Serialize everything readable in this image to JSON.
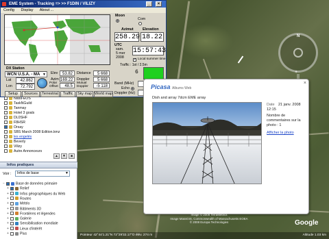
{
  "eme_window": {
    "title": "EME System - Tracking => >> F1DIN / VILIZY",
    "menu": [
      "Config",
      "Display",
      "About ..."
    ],
    "moon_label": "Moon",
    "com_label": "Com",
    "azimut_label": "Azimut",
    "elevation_label": "Elevation",
    "azimut_value": "258.29",
    "elevation_value": "18.22",
    "utc_label": "UTC",
    "date_line1": "sam.",
    "date_line2": "5 mer",
    "date_line3": "2008",
    "utc_time": "15:57:43",
    "local_summer_time_label": "Local summer time",
    "traffic_label": "Traffic : 1st / 2.5m",
    "dx_station_label": "DX Station",
    "dx_station_value": "WCN U.S.A. - MA",
    "lat_label": "Lat",
    "lat_value": "42.862",
    "lon_label": "Lon",
    "lon_value": "72.792",
    "elev_label": "Elev",
    "elev_value": "53.82",
    "distance_label": "Distance",
    "distance_value": "5 668",
    "azim_label": "Azim",
    "azim_value": "169.22",
    "doppler_label": "Doppler",
    "doppler_value": "5 668",
    "polar_offset_label": "Polar Offset",
    "polar_offset_value": "48.5",
    "mutual_doppler_label": "Mutual Doppler",
    "mutual_doppler_value": "-5 118",
    "band_label": "Band (MHz)",
    "band_value": "10 368",
    "echo_label": "Echo",
    "doppler_hz_label": "Doppler (Hz)",
    "doppler_hz_value": "-15 861",
    "indicator_value": "6",
    "buttons": [
      "Setup",
      "Sources",
      "Terrestrial",
      "Traffic",
      "Sky map",
      "World map"
    ]
  },
  "sidebar": {
    "tree_items": [
      {
        "label": "Nasa-EOS",
        "checked": false
      },
      {
        "label": "TaskNGuild",
        "checked": false
      },
      {
        "label": "Tanmay",
        "checked": false
      },
      {
        "label": "Hotel 3 goals",
        "checked": false
      },
      {
        "label": "DL0SHF",
        "checked": false
      },
      {
        "label": "F8HSR",
        "checked": false
      },
      {
        "label": "Orsay",
        "checked": true
      },
      {
        "label": "SBS March 2008 Edition.kmz",
        "checked": false
      },
      {
        "label": "les engelés",
        "checked": false
      },
      {
        "label": "Beverly",
        "checked": false
      },
      {
        "label": "Vilizy",
        "checked": false
      },
      {
        "label": "Autre Annonceurs",
        "checked": false
      }
    ],
    "infos_pratiques_header": "Infos pratiques",
    "view_label": "Voir :",
    "view_select": "Infos de base",
    "layers": [
      {
        "label": "Base de données primaire",
        "checked": true
      },
      {
        "label": "Relief",
        "checked": true
      },
      {
        "label": "Infos géographiques du Web",
        "checked": false
      },
      {
        "label": "Routes",
        "checked": false
      },
      {
        "label": "Météo",
        "checked": false
      },
      {
        "label": "Bâtiments 3D",
        "checked": false
      },
      {
        "label": "Frontières et légendes",
        "checked": false
      },
      {
        "label": "Galerie",
        "checked": false
      },
      {
        "label": "Sensibilisation mondiale",
        "checked": false
      },
      {
        "label": "Lieux d'intérêt",
        "checked": false
      },
      {
        "label": "Plus",
        "checked": false
      }
    ]
  },
  "popup": {
    "brand": "Picasa",
    "brand_suffix": "Albums Web",
    "caption": "Dish and array 7dcm EME array",
    "date_label": "Date",
    "date_value": "21 janv. 2008",
    "time_value": "12:15",
    "comments_text": "Nombre de commentaires sur la photo : 1",
    "view_link": "Afficher la photo"
  },
  "map": {
    "copyright": "Image © 2008 TerraMetrics\nImage MassGIS, Commonwealth of Massachusetts EOEA\n© 2008 Europa Technologies",
    "status_left": "Pointeur  42°44'1.21\"N  72°29'32.17\"O  élév.  274 m",
    "status_right": "Altitude  1.03 km",
    "google_logo": "Google"
  }
}
